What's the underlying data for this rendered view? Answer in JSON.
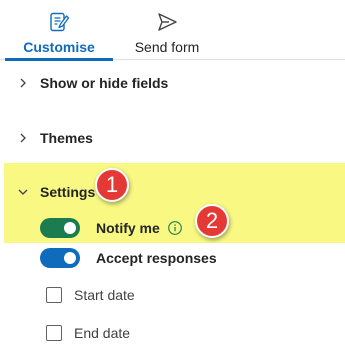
{
  "tabs": {
    "customise": {
      "label": "Customise",
      "icon": "customise-icon",
      "active": true
    },
    "send_form": {
      "label": "Send form",
      "icon": "send-icon"
    }
  },
  "sections": {
    "show_hide_fields": {
      "label": "Show or hide fields",
      "expanded": false
    },
    "themes": {
      "label": "Themes",
      "expanded": false
    },
    "settings": {
      "label": "Settings",
      "expanded": true
    }
  },
  "settings": {
    "notify_me": {
      "label": "Notify me",
      "on": true,
      "info_icon": "info-icon"
    },
    "accept_responses": {
      "label": "Accept responses",
      "on": true
    },
    "start_date": {
      "label": "Start date",
      "checked": false
    },
    "end_date": {
      "label": "End date",
      "checked": false
    }
  },
  "annotations": {
    "step1": "1",
    "step2": "2"
  },
  "colors": {
    "accent": "#0f6cbd",
    "notify_toggle": "#1a7c4f",
    "highlight": "#f8f883",
    "callout": "#e53935"
  }
}
